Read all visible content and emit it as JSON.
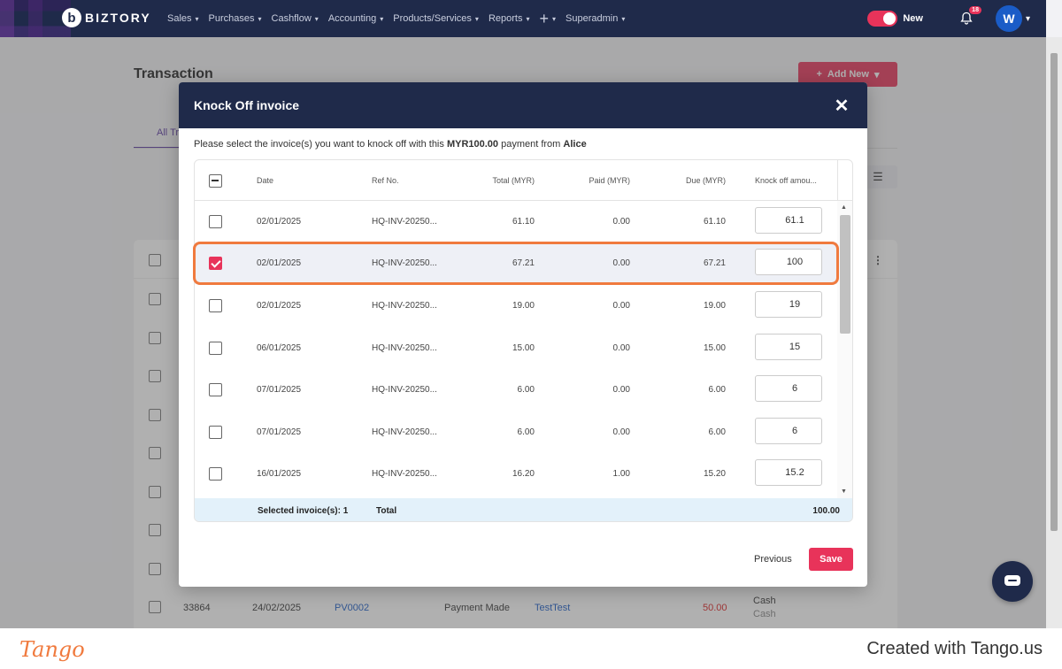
{
  "nav": {
    "brand": "BIZTORY",
    "brand_mark": "b",
    "menu": [
      "Sales",
      "Purchases",
      "Cashflow",
      "Accounting",
      "Products/Services",
      "Reports",
      "+",
      "Superadmin"
    ],
    "toggle_label": "New",
    "notification_count": "18",
    "avatar_initial": "W"
  },
  "page": {
    "title": "Transaction",
    "add_new_label": "Add New",
    "tab_label": "All Tr",
    "last_row": {
      "id": "33864",
      "date": "24/02/2025",
      "ref": "PV0002",
      "type": "Payment Made",
      "contact": "TestTest",
      "amount": "50.00",
      "method_1": "Cash",
      "method_2": "Cash"
    }
  },
  "modal": {
    "title": "Knock Off invoice",
    "message_prefix": "Please select the invoice(s) you want to knock off with this ",
    "amount": "MYR100.00",
    "message_middle": " payment from ",
    "payer": "Alice",
    "columns": {
      "date": "Date",
      "ref": "Ref No.",
      "total": "Total (MYR)",
      "paid": "Paid (MYR)",
      "due": "Due (MYR)",
      "knock_off": "Knock off amou..."
    },
    "rows": [
      {
        "date": "02/01/2025",
        "ref": "HQ-INV-20250...",
        "total": "61.10",
        "paid": "0.00",
        "due": "61.10",
        "knock_off": "61.1",
        "checked": false
      },
      {
        "date": "02/01/2025",
        "ref": "HQ-INV-20250...",
        "total": "67.21",
        "paid": "0.00",
        "due": "67.21",
        "knock_off": "100",
        "checked": true
      },
      {
        "date": "02/01/2025",
        "ref": "HQ-INV-20250...",
        "total": "19.00",
        "paid": "0.00",
        "due": "19.00",
        "knock_off": "19",
        "checked": false
      },
      {
        "date": "06/01/2025",
        "ref": "HQ-INV-20250...",
        "total": "15.00",
        "paid": "0.00",
        "due": "15.00",
        "knock_off": "15",
        "checked": false
      },
      {
        "date": "07/01/2025",
        "ref": "HQ-INV-20250...",
        "total": "6.00",
        "paid": "0.00",
        "due": "6.00",
        "knock_off": "6",
        "checked": false
      },
      {
        "date": "07/01/2025",
        "ref": "HQ-INV-20250...",
        "total": "6.00",
        "paid": "0.00",
        "due": "6.00",
        "knock_off": "6",
        "checked": false
      },
      {
        "date": "16/01/2025",
        "ref": "HQ-INV-20250...",
        "total": "16.20",
        "paid": "1.00",
        "due": "15.20",
        "knock_off": "15.2",
        "checked": false
      }
    ],
    "footer": {
      "selected_label": "Selected invoice(s): 1",
      "total_label": "Total",
      "total_value": "100.00"
    },
    "previous_label": "Previous",
    "save_label": "Save"
  },
  "tango": {
    "logo": "Tango",
    "credit": "Created with Tango.us"
  },
  "colors": {
    "nav_bg": "#1f2a4a",
    "accent": "#e8335a",
    "highlight": "#f07a3e",
    "footer_bg": "#e3f1fa"
  }
}
